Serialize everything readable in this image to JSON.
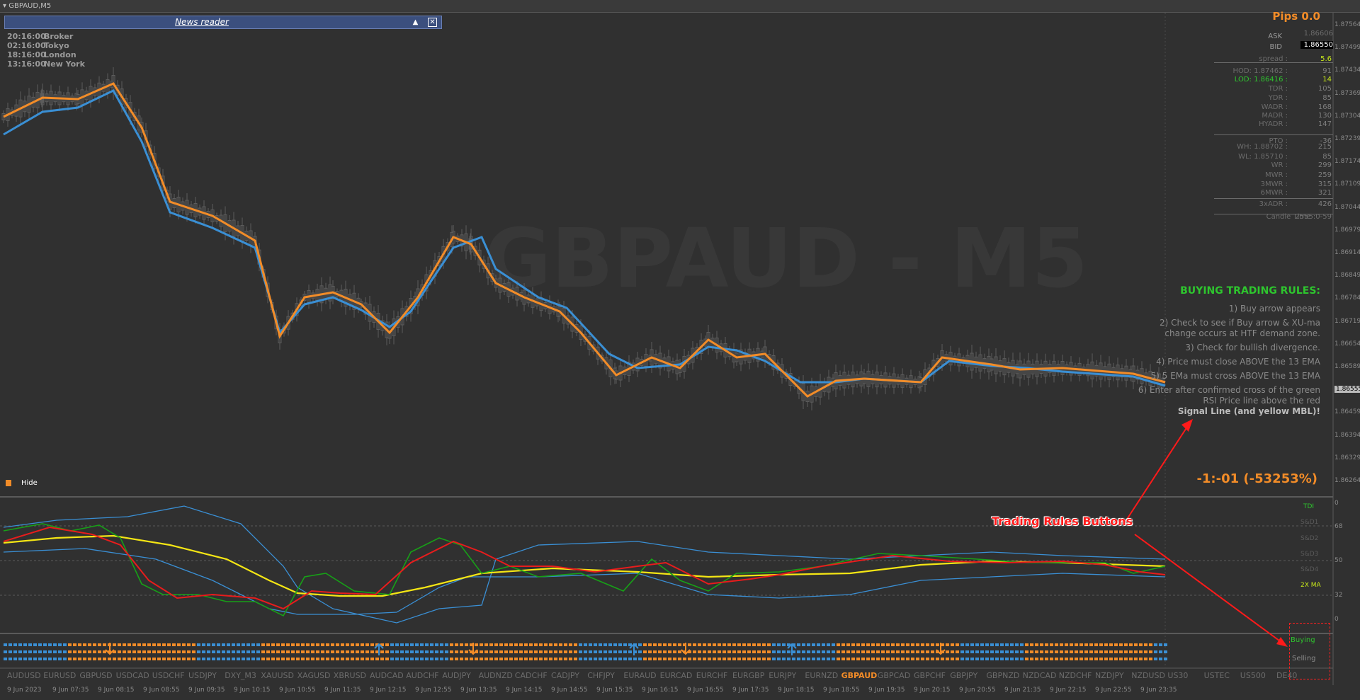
{
  "window": {
    "title": "GBPAUD,M5"
  },
  "watermark": "GBPAUD - M5",
  "news_reader": {
    "title": "News reader",
    "collapse_icon": "▲",
    "close_icon": "✕"
  },
  "sessions": [
    {
      "time": "20:16:00",
      "name": "Broker"
    },
    {
      "time": "02:16:00",
      "name": "Tokyo"
    },
    {
      "time": "18:16:00",
      "name": "London"
    },
    {
      "time": "13:16:00",
      "name": "New York"
    }
  ],
  "pips": "Pips 0.0",
  "info_panel": {
    "ask_label": "ASK",
    "ask_value": "1.86606",
    "bid_label": "BID",
    "bid_value": "1.86550",
    "rows": [
      {
        "label": "spread :",
        "value": "5.6",
        "value_color": "#c8e81a"
      },
      {
        "label": "HOD: 1.87462 :",
        "value": "91",
        "value_color": "#7d7d7d"
      },
      {
        "label": "LOD: 1.86416 :",
        "value": "14",
        "value_color": "#c8e81a"
      },
      {
        "label": "TDR :",
        "value": "105",
        "value_color": "#7d7d7d"
      },
      {
        "label": "YDR :",
        "value": "85",
        "value_color": "#7d7d7d"
      },
      {
        "label": "WADR :",
        "value": "168",
        "value_color": "#7d7d7d"
      },
      {
        "label": "MADR :",
        "value": "130",
        "value_color": "#7d7d7d"
      },
      {
        "label": "HYADR :",
        "value": "147",
        "value_color": "#7d7d7d"
      },
      {
        "label": "PTO :",
        "value": "-36",
        "value_color": "#7d7d7d"
      },
      {
        "label": "WH: 1.88702 :",
        "value": "215",
        "value_color": "#7d7d7d"
      },
      {
        "label": "WL: 1.85710 :",
        "value": "85",
        "value_color": "#7d7d7d"
      },
      {
        "label": "WR :",
        "value": "299",
        "value_color": "#7d7d7d"
      },
      {
        "label": "MWR :",
        "value": "259",
        "value_color": "#7d7d7d"
      },
      {
        "label": "3MWR :",
        "value": "315",
        "value_color": "#7d7d7d"
      },
      {
        "label": "6MWR :",
        "value": "321",
        "value_color": "#7d7d7d"
      },
      {
        "label": "3xADR :",
        "value": "426",
        "value_color": "#7d7d7d"
      }
    ],
    "candle_time_label": "Candle Time",
    "candle_time_value": "2555:0-59"
  },
  "rules": {
    "heading": "BUYING TRADING RULES:",
    "items": [
      "1) Buy arrow appears",
      "2) Check to see if Buy arrow & XU-ma change occurs at HTF demand zone.",
      "3) Check for bullish divergence.",
      "4) Price must close ABOVE the 13 EMA",
      "5) 5 EMa must cross ABOVE the 13 EMA",
      "6) Enter after confirmed cross of the green RSI Price line above the red"
    ],
    "item_bold": "Signal Line (and yellow MBL)!"
  },
  "ratio": "-1:-01 (-53253%)",
  "hide_label": "Hide",
  "annotation": "Trading Rules Buttons",
  "buttons": {
    "buy": "Buying",
    "sell": "Selling"
  },
  "tdi_labels": {
    "tdi": "TDI",
    "sd1": "S&D1",
    "sd2": "S&D2",
    "sd3": "S&D3",
    "sd4": "S&D4",
    "ma": "2X MA",
    "levels": [
      "0",
      "68",
      "50",
      "32",
      "0"
    ]
  },
  "symbols": [
    "AUDUSD",
    "EURUSD",
    "GBPUSD",
    "USDCAD",
    "USDCHF",
    "USDJPY",
    "DXY_M3",
    "XAUUSD",
    "XAGUSD",
    "XBRUSD",
    "AUDCAD",
    "AUDCHF",
    "AUDJPY",
    "AUDNZD",
    "CADCHF",
    "CADJPY",
    "CHFJPY",
    "EURAUD",
    "EURCAD",
    "EURCHF",
    "EURGBP",
    "EURJPY",
    "EURNZD",
    "GBPAUD",
    "GBPCAD",
    "GBPCHF",
    "GBPJPY",
    "GBPNZD",
    "NZDCAD",
    "NZDCHF",
    "NZDJPY",
    "NZDUSD",
    "US30",
    "USTEC",
    "US500",
    "DE40"
  ],
  "active_symbol": "GBPAUD",
  "time_labels": [
    "9 Jun 2023",
    "9 Jun 07:35",
    "9 Jun 08:15",
    "9 Jun 08:55",
    "9 Jun 09:35",
    "9 Jun 10:15",
    "9 Jun 10:55",
    "9 Jun 11:35",
    "9 Jun 12:15",
    "9 Jun 12:55",
    "9 Jun 13:35",
    "9 Jun 14:15",
    "9 Jun 14:55",
    "9 Jun 15:35",
    "9 Jun 16:15",
    "9 Jun 16:55",
    "9 Jun 17:35",
    "9 Jun 18:15",
    "9 Jun 18:55",
    "9 Jun 19:35",
    "9 Jun 20:15",
    "9 Jun 20:55",
    "9 Jun 21:35",
    "9 Jun 22:15",
    "9 Jun 22:55",
    "9 Jun 23:35"
  ],
  "price_labels": [
    "1.87564",
    "1.87499",
    "1.87434",
    "1.87369",
    "1.87304",
    "1.87239",
    "1.87174",
    "1.87109",
    "1.87044",
    "1.86979",
    "1.86914",
    "1.86849",
    "1.86784",
    "1.86719",
    "1.86654",
    "1.86589",
    "1.86524",
    "1.86459",
    "1.86394",
    "1.86329",
    "1.86264"
  ],
  "current_price": "1.86555",
  "colors": {
    "ema_fast": "#f28c28",
    "ema_slow_up": "#3a8fd4",
    "rsi": "#17a017",
    "signal": "#e81c1c",
    "mbl": "#f5e614",
    "bands": "#3a8fd4",
    "accent": "#f28c28"
  }
}
